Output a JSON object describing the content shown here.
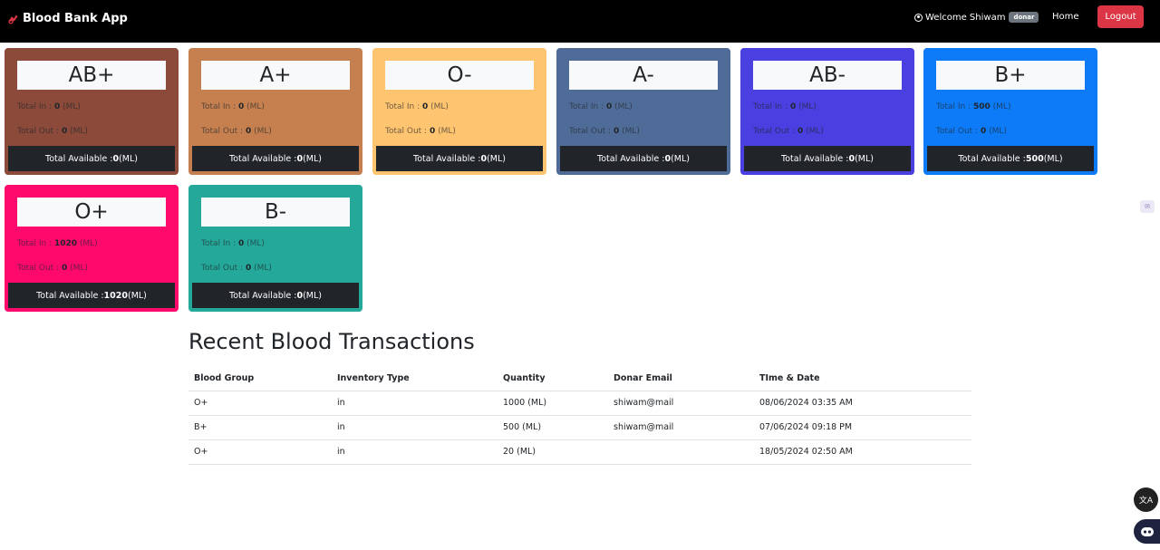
{
  "navbar": {
    "brand": "Blood Bank App",
    "welcome": "Welcome Shiwam",
    "role_badge": "donar",
    "home": "Home",
    "logout": "Logout"
  },
  "cards": [
    {
      "group": "AB+",
      "total_in_label": "Total In : ",
      "total_in": "0",
      "in_unit": " (ML)",
      "total_out_label": "Total Out : ",
      "total_out": "0",
      "out_unit": " (ML)",
      "avail_label": "Total Available : ",
      "available": "0",
      "avail_unit": " (ML)",
      "color": "#8b4a3a"
    },
    {
      "group": "A+",
      "total_in_label": "Total In : ",
      "total_in": "0",
      "in_unit": " (ML)",
      "total_out_label": "Total Out : ",
      "total_out": "0",
      "out_unit": " (ML)",
      "avail_label": "Total Available : ",
      "available": "0",
      "avail_unit": " (ML)",
      "color": "#c6804f"
    },
    {
      "group": "O-",
      "total_in_label": "Total In : ",
      "total_in": "0",
      "in_unit": " (ML)",
      "total_out_label": "Total Out : ",
      "total_out": "0",
      "out_unit": " (ML)",
      "avail_label": "Total Available : ",
      "available": "0",
      "avail_unit": " (ML)",
      "color": "#ffc470"
    },
    {
      "group": "A-",
      "total_in_label": "Total In : ",
      "total_in": "0",
      "in_unit": " (ML)",
      "total_out_label": "Total Out : ",
      "total_out": "0",
      "out_unit": " (ML)",
      "avail_label": "Total Available : ",
      "available": "0",
      "avail_unit": " (ML)",
      "color": "#4f6c98"
    },
    {
      "group": "AB-",
      "total_in_label": "Total In : ",
      "total_in": "0",
      "in_unit": " (ML)",
      "total_out_label": "Total Out : ",
      "total_out": "0",
      "out_unit": " (ML)",
      "avail_label": "Total Available : ",
      "available": "0",
      "avail_unit": " (ML)",
      "color": "#4a3fe0"
    },
    {
      "group": "B+",
      "total_in_label": "Total In : ",
      "total_in": "500",
      "in_unit": " (ML)",
      "total_out_label": "Total Out : ",
      "total_out": "0",
      "out_unit": " (ML)",
      "avail_label": "Total Available : ",
      "available": "500",
      "avail_unit": " (ML)",
      "color": "#0d7bf7"
    },
    {
      "group": "O+",
      "total_in_label": "Total In : ",
      "total_in": "1020",
      "in_unit": " (ML)",
      "total_out_label": "Total Out : ",
      "total_out": "0",
      "out_unit": " (ML)",
      "avail_label": "Total Available : ",
      "available": "1020",
      "avail_unit": " (ML)",
      "color": "#ff0a6c"
    },
    {
      "group": "B-",
      "total_in_label": "Total In : ",
      "total_in": "0",
      "in_unit": " (ML)",
      "total_out_label": "Total Out : ",
      "total_out": "0",
      "out_unit": " (ML)",
      "avail_label": "Total Available : ",
      "available": "0",
      "avail_unit": " (ML)",
      "color": "#24a89a"
    }
  ],
  "transactions": {
    "title": "Recent Blood Transactions",
    "headers": [
      "Blood Group",
      "Inventory Type",
      "Quantity",
      "Donar Email",
      "TIme & Date"
    ],
    "rows": [
      [
        "O+",
        "in",
        "1000 (ML)",
        "shiwam@mail",
        "08/06/2024 03:35 AM"
      ],
      [
        "B+",
        "in",
        "500 (ML)",
        "shiwam@mail",
        "07/06/2024 09:18 PM"
      ],
      [
        "O+",
        "in",
        "20 (ML)",
        "",
        "18/05/2024 02:50 AM"
      ]
    ]
  },
  "icons": {
    "brand": "blood-drop-icon",
    "user": "user-circle-icon",
    "translate": "translate-icon",
    "assistant": "assistant-bot-icon",
    "side": "side-widget-icon"
  }
}
